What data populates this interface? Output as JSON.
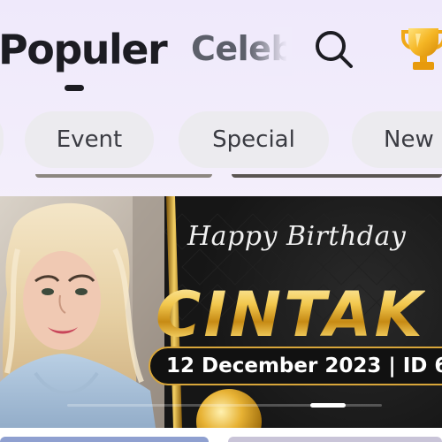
{
  "tabs": {
    "active": "Populer",
    "next": "Celeb"
  },
  "icons": {
    "search": "search-icon",
    "trophy": "trophy-icon"
  },
  "chips": [
    {
      "label": ""
    },
    {
      "label": "Event"
    },
    {
      "label": "Special"
    },
    {
      "label": "New"
    }
  ],
  "banner": {
    "greeting": "Happy Birthday",
    "name": "CINTAK",
    "date_line": "12 December 2023 | ID 6"
  },
  "colors": {
    "tab_text": "#1c1c22",
    "tab_inactive": "#5c5f6a",
    "chip_bg": "#ecebef",
    "gold": "#e7b83a",
    "banner_bg": "#141414"
  }
}
